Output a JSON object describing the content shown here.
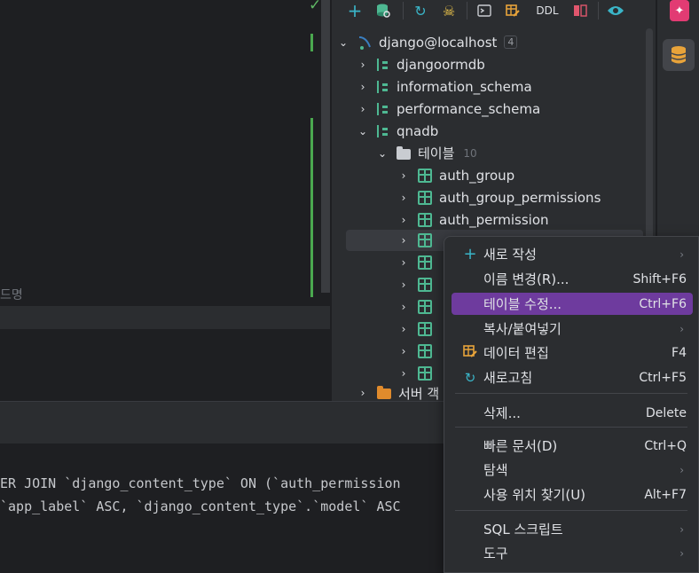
{
  "editor": {
    "faded_text": "드명",
    "code_lines": [
      "ER JOIN `django_content_type` ON (`auth_permission",
      "`app_label` ASC, `django_content_type`.`model` ASC"
    ]
  },
  "toolbar": {
    "ddl_label": "DDL"
  },
  "tree": {
    "connection": {
      "label": "django@localhost",
      "count": "4"
    },
    "schemas": [
      {
        "label": "djangoormdb"
      },
      {
        "label": "information_schema"
      },
      {
        "label": "performance_schema"
      },
      {
        "label": "qnadb"
      }
    ],
    "tables_folder": {
      "label": "테이블",
      "count": "10"
    },
    "tables": [
      {
        "label": "auth_group"
      },
      {
        "label": "auth_group_permissions"
      },
      {
        "label": "auth_permission"
      }
    ],
    "partial_folder_label": "서버 객"
  },
  "context_menu": {
    "items": [
      {
        "label": "새로 작성",
        "shortcut": "",
        "submenu": true,
        "icon": "plus-icon"
      },
      {
        "label": "이름 변경(R)...",
        "shortcut": "Shift+F6",
        "submenu": false,
        "icon": ""
      },
      {
        "label": "테이블 수정...",
        "shortcut": "Ctrl+F6",
        "submenu": false,
        "icon": "",
        "selected": true
      },
      {
        "label": "복사/붙여넣기",
        "shortcut": "",
        "submenu": true,
        "icon": ""
      },
      {
        "label": "데이터 편집",
        "shortcut": "F4",
        "submenu": false,
        "icon": "table-edit-icon"
      },
      {
        "label": "새로고침",
        "shortcut": "Ctrl+F5",
        "submenu": false,
        "icon": "refresh-icon"
      },
      {
        "label": "삭제...",
        "shortcut": "Delete",
        "submenu": false,
        "icon": ""
      },
      {
        "label": "빠른 문서(D)",
        "shortcut": "Ctrl+Q",
        "submenu": false,
        "icon": ""
      },
      {
        "label": "탐색",
        "shortcut": "",
        "submenu": true,
        "icon": ""
      },
      {
        "label": "사용 위치 찾기(U)",
        "shortcut": "Alt+F7",
        "submenu": false,
        "icon": ""
      },
      {
        "label": "SQL 스크립트",
        "shortcut": "",
        "submenu": true,
        "icon": ""
      },
      {
        "label": "도구",
        "shortcut": "",
        "submenu": true,
        "icon": ""
      }
    ]
  },
  "colors": {
    "accent_selection": "#6e3b9e",
    "schema_icon": "#4eb892",
    "ai_button": "#e23b73",
    "db_icon": "#e8a33a"
  }
}
